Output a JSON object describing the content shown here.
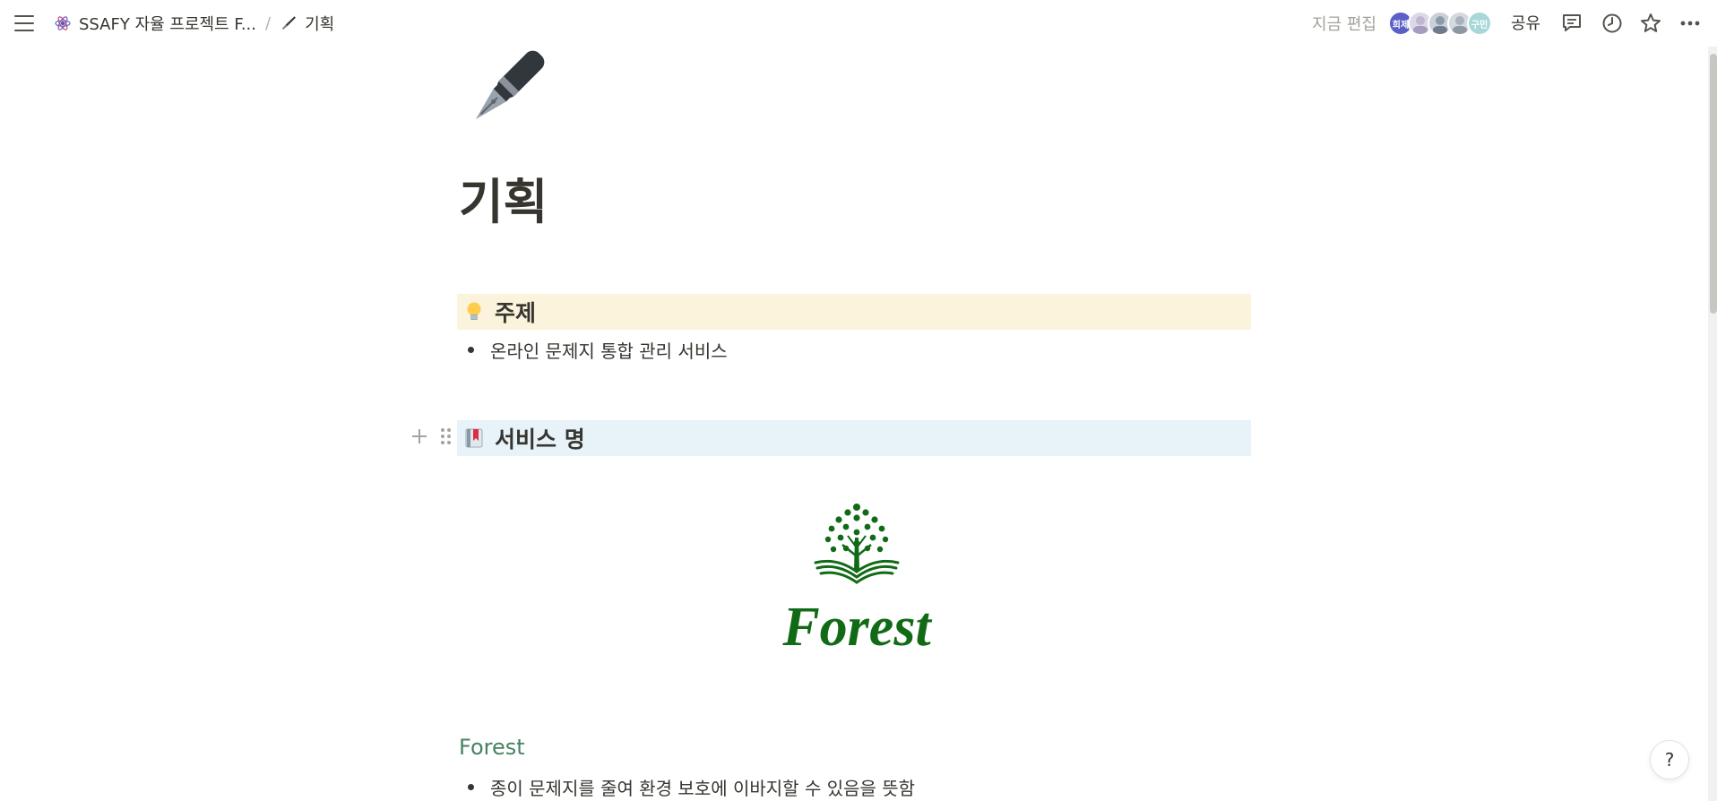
{
  "topbar": {
    "breadcrumb": [
      {
        "label": "SSAFY 자율 프로젝트 F...",
        "icon": "workspace-atom-icon"
      },
      {
        "label": "기획",
        "icon": "pen-icon"
      }
    ],
    "separator": "/",
    "editing_status": "지금 편집",
    "avatars": [
      {
        "initials": "희제",
        "color": "#5b5fc7"
      },
      {
        "initials": "",
        "color": "#d9d6e8"
      },
      {
        "initials": "",
        "color": "#c5ccd6"
      },
      {
        "initials": "",
        "color": "#cfd6dc"
      },
      {
        "initials": "구민",
        "color": "#a7d8d8"
      }
    ],
    "share_label": "공유",
    "icons": [
      "comment-icon",
      "clock-icon",
      "star-icon",
      "more-icon"
    ]
  },
  "page": {
    "title": "기획",
    "icon": "fountain-pen-icon"
  },
  "sections": {
    "topic": {
      "heading": "주제",
      "emoji": "lightbulb-icon",
      "bg": "#fbf3db",
      "bullets": [
        "온라인 문제지 통합 관리 서비스"
      ]
    },
    "service_name": {
      "heading": "서비스 명",
      "emoji": "bookmark-icon",
      "bg": "#e7f3f8",
      "logo_text": "Forest",
      "logo_color": "#116b16"
    },
    "forest": {
      "heading": "Forest",
      "heading_color": "#448361",
      "bullets": [
        "종이 문제지를 줄여 환경 보호에 이바지할 수 있음을 뜻함"
      ]
    }
  },
  "help_label": "?"
}
